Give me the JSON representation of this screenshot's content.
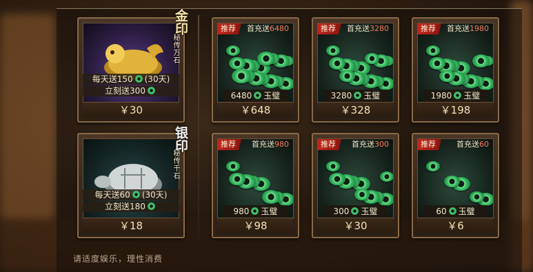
{
  "footer_note": "请适度娱乐，理性消费",
  "seals": [
    {
      "title": "金印",
      "subtitle": "秘传万石",
      "daily": "每天送150",
      "daily_suffix": "(30天)",
      "instant": "立刻送300",
      "price": "￥30"
    },
    {
      "title": "银印",
      "subtitle": "秘传千石",
      "daily": "每天送60",
      "daily_suffix": "(30天)",
      "instant": "立刻送180",
      "price": "￥18"
    }
  ],
  "packs": [
    {
      "tag": "推荐",
      "bonus_prefix": "首充送",
      "bonus_amount": "6480",
      "amount": "6480",
      "unit": "玉璧",
      "price": "￥648"
    },
    {
      "tag": "推荐",
      "bonus_prefix": "首充送",
      "bonus_amount": "3280",
      "amount": "3280",
      "unit": "玉璧",
      "price": "￥328"
    },
    {
      "tag": "推荐",
      "bonus_prefix": "首充送",
      "bonus_amount": "1980",
      "amount": "1980",
      "unit": "玉璧",
      "price": "￥198"
    },
    {
      "tag": "推荐",
      "bonus_prefix": "首充送",
      "bonus_amount": "980",
      "amount": "980",
      "unit": "玉璧",
      "price": "￥98"
    },
    {
      "tag": "推荐",
      "bonus_prefix": "首充送",
      "bonus_amount": "300",
      "amount": "300",
      "unit": "玉璧",
      "price": "￥30"
    },
    {
      "tag": "推荐",
      "bonus_prefix": "首充送",
      "bonus_amount": "60",
      "amount": "60",
      "unit": "玉璧",
      "price": "￥6"
    }
  ],
  "colors": {
    "accent_gold": "#f6e2a8",
    "tag_red": "#c0261c",
    "jade_green": "#2fae5a"
  },
  "icons": {
    "currency": "jade-coin-icon"
  }
}
